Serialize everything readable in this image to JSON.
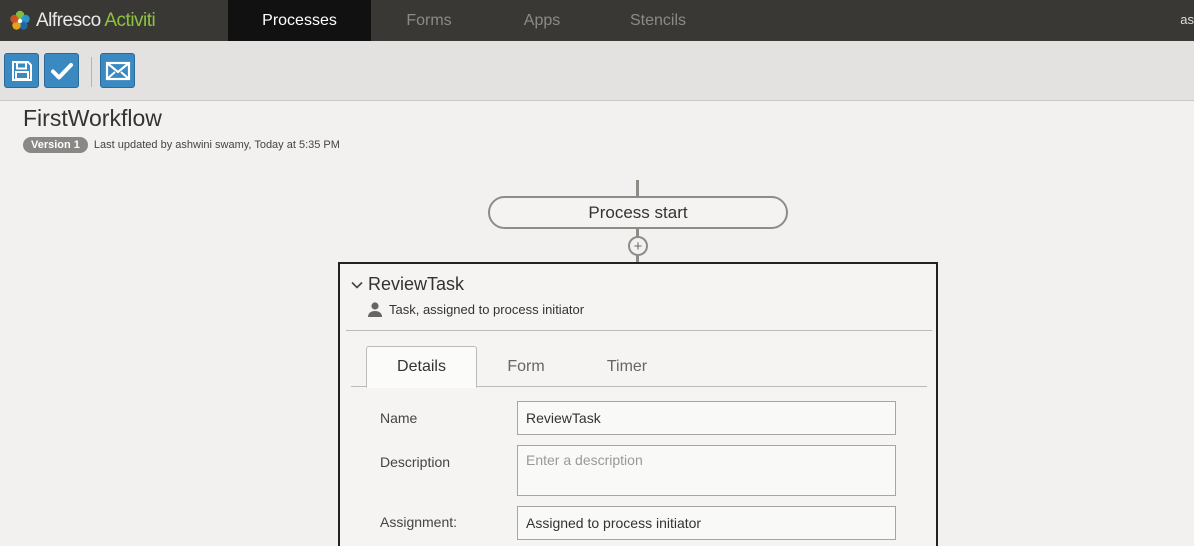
{
  "app": {
    "logo_primary": "Alfresco",
    "logo_secondary": "Activiti"
  },
  "nav": {
    "tabs": [
      {
        "label": "Processes",
        "active": true
      },
      {
        "label": "Forms",
        "active": false
      },
      {
        "label": "Apps",
        "active": false
      },
      {
        "label": "Stencils",
        "active": false
      }
    ],
    "user_initials": "as"
  },
  "toolbar": {
    "buttons": [
      {
        "icon": "floppy-disk-icon"
      },
      {
        "icon": "checkmark-icon"
      },
      {
        "icon": "envelope-icon"
      }
    ]
  },
  "page": {
    "title": "FirstWorkflow",
    "version_badge": "Version 1",
    "last_updated": "Last updated by ashwini swamy, Today at 5:35 PM"
  },
  "flow": {
    "start_node_label": "Process start",
    "add_icon": "plus-circle-icon"
  },
  "step": {
    "title": "ReviewTask",
    "subtitle": "Task, assigned to process initiator",
    "tabs": [
      {
        "label": "Details",
        "active": true
      },
      {
        "label": "Form",
        "active": false
      },
      {
        "label": "Timer",
        "active": false
      }
    ],
    "fields": {
      "name_label": "Name",
      "name_value": "ReviewTask",
      "description_label": "Description",
      "description_value": "",
      "description_placeholder": "Enter a description",
      "assignment_label": "Assignment:",
      "assignment_value": "Assigned to process initiator"
    }
  },
  "colors": {
    "topbar": "#3a3835",
    "active_tab": "#111111",
    "toolbar_button": "#3a89c1",
    "logo_green": "#8cc43f",
    "connector": "#8f8b87"
  }
}
